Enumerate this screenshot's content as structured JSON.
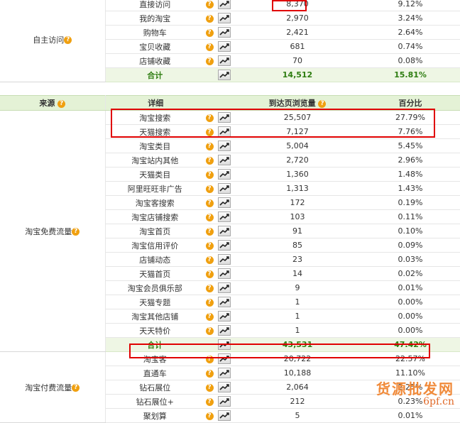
{
  "sections": [
    {
      "source": "自主访问",
      "rows": [
        {
          "name": "直接访问",
          "value": "8,370",
          "pct": "9.12%"
        },
        {
          "name": "我的淘宝",
          "value": "2,970",
          "pct": "3.24%"
        },
        {
          "name": "购物车",
          "value": "2,421",
          "pct": "2.64%"
        },
        {
          "name": "宝贝收藏",
          "value": "681",
          "pct": "0.74%"
        },
        {
          "name": "店铺收藏",
          "value": "70",
          "pct": "0.08%"
        }
      ],
      "total": {
        "label": "合计",
        "value": "14,512",
        "pct": "15.81%"
      }
    },
    {
      "source": "淘宝免费流量",
      "rows": [
        {
          "name": "淘宝搜索",
          "value": "25,507",
          "pct": "27.79%"
        },
        {
          "name": "天猫搜索",
          "value": "7,127",
          "pct": "7.76%"
        },
        {
          "name": "淘宝类目",
          "value": "5,004",
          "pct": "5.45%"
        },
        {
          "name": "淘宝站内其他",
          "value": "2,720",
          "pct": "2.96%"
        },
        {
          "name": "天猫类目",
          "value": "1,360",
          "pct": "1.48%"
        },
        {
          "name": "阿里旺旺非广告",
          "value": "1,313",
          "pct": "1.43%"
        },
        {
          "name": "淘宝客搜索",
          "value": "172",
          "pct": "0.19%"
        },
        {
          "name": "淘宝店铺搜索",
          "value": "103",
          "pct": "0.11%"
        },
        {
          "name": "淘宝首页",
          "value": "91",
          "pct": "0.10%"
        },
        {
          "name": "淘宝信用评价",
          "value": "85",
          "pct": "0.09%"
        },
        {
          "name": "店铺动态",
          "value": "23",
          "pct": "0.03%"
        },
        {
          "name": "天猫首页",
          "value": "14",
          "pct": "0.02%"
        },
        {
          "name": "淘宝会员俱乐部",
          "value": "9",
          "pct": "0.01%"
        },
        {
          "name": "天猫专题",
          "value": "1",
          "pct": "0.00%"
        },
        {
          "name": "淘宝其他店铺",
          "value": "1",
          "pct": "0.00%"
        },
        {
          "name": "天天特价",
          "value": "1",
          "pct": "0.00%"
        }
      ],
      "total": {
        "label": "合计",
        "value": "43,531",
        "pct": "47.42%"
      }
    },
    {
      "source": "淘宝付费流量",
      "rows": [
        {
          "name": "淘宝客",
          "value": "20,722",
          "pct": "22.57%"
        },
        {
          "name": "直通车",
          "value": "10,188",
          "pct": "11.10%"
        },
        {
          "name": "钻石展位",
          "value": "2,064",
          "pct": "2.25%"
        },
        {
          "name": "钻石展位+",
          "value": "212",
          "pct": "0.23%"
        },
        {
          "name": "聚划算",
          "value": "5",
          "pct": "0.01%"
        }
      ]
    }
  ],
  "header": {
    "source": "来源",
    "detail": "详细",
    "views": "到达页浏览量",
    "percent": "百分比"
  },
  "watermark": {
    "text": "货源批发网",
    "url": "6pf.cn"
  },
  "colors": {
    "header_bg": "#e4f2d6",
    "total_text": "#2e7d11",
    "highlight": "#e00000",
    "help_icon": "#f0a010"
  }
}
